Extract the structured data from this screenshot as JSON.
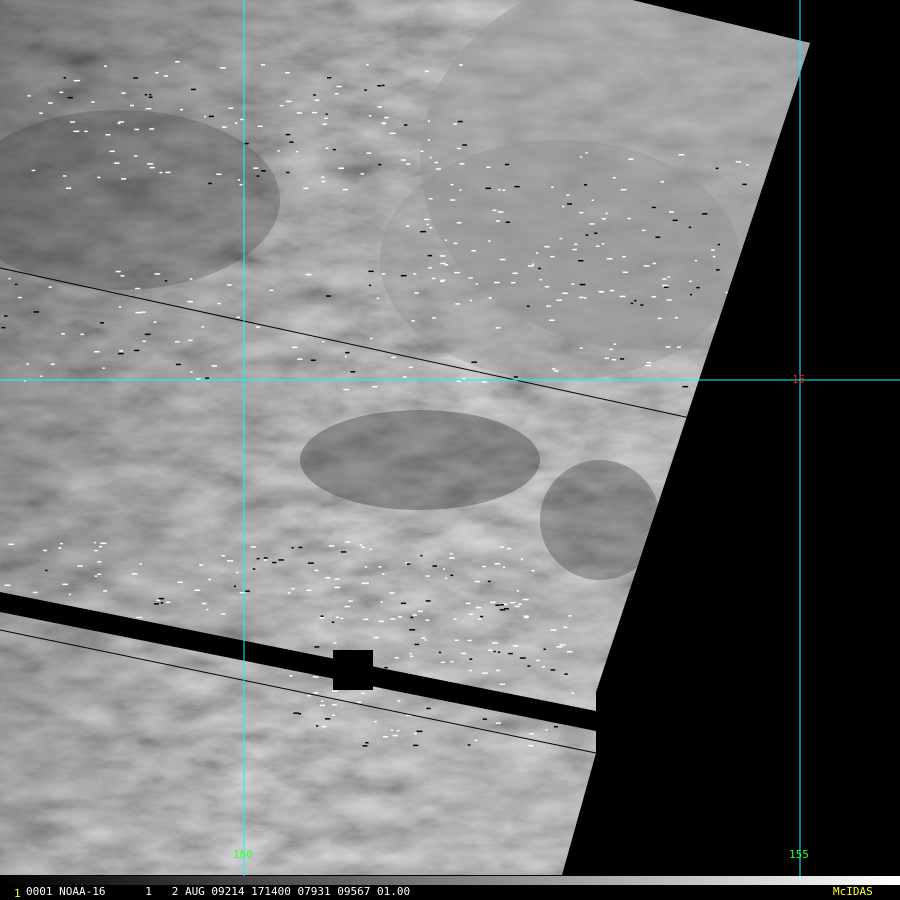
{
  "colors": {
    "grid_line": "#00ffff",
    "lat_label": "#ff2020",
    "lon_label": "#33ff33",
    "status_text": "#ffffff",
    "brand": "#ffff33",
    "frame_num": "#ffff33",
    "background": "#000000"
  },
  "grid": {
    "latitude_labels": [
      "15"
    ],
    "longitude_labels": [
      "160",
      "155"
    ]
  },
  "status_bar": {
    "frame_number": "1",
    "text": "0001 NOAA-16      1   2 AUG 09214 171400 07931 09567 01.00",
    "brand": "McIDAS"
  }
}
